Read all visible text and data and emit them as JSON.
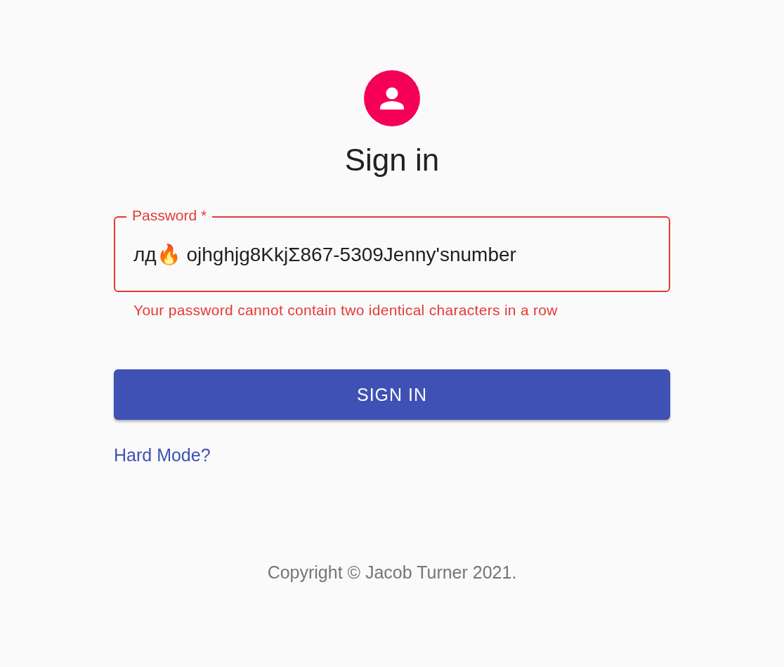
{
  "title": "Sign in",
  "password_field": {
    "label": "Password",
    "required_mark": "*",
    "value": "лд🔥 ojhghjg8KkjΣ867-5309Jenny'snumber",
    "error": true,
    "helper_text": "Your password cannot contain two identical characters in a row"
  },
  "submit_button": {
    "label": "SIGN IN"
  },
  "link": {
    "label": "Hard Mode?"
  },
  "copyright": "Copyright © Jacob Turner 2021."
}
